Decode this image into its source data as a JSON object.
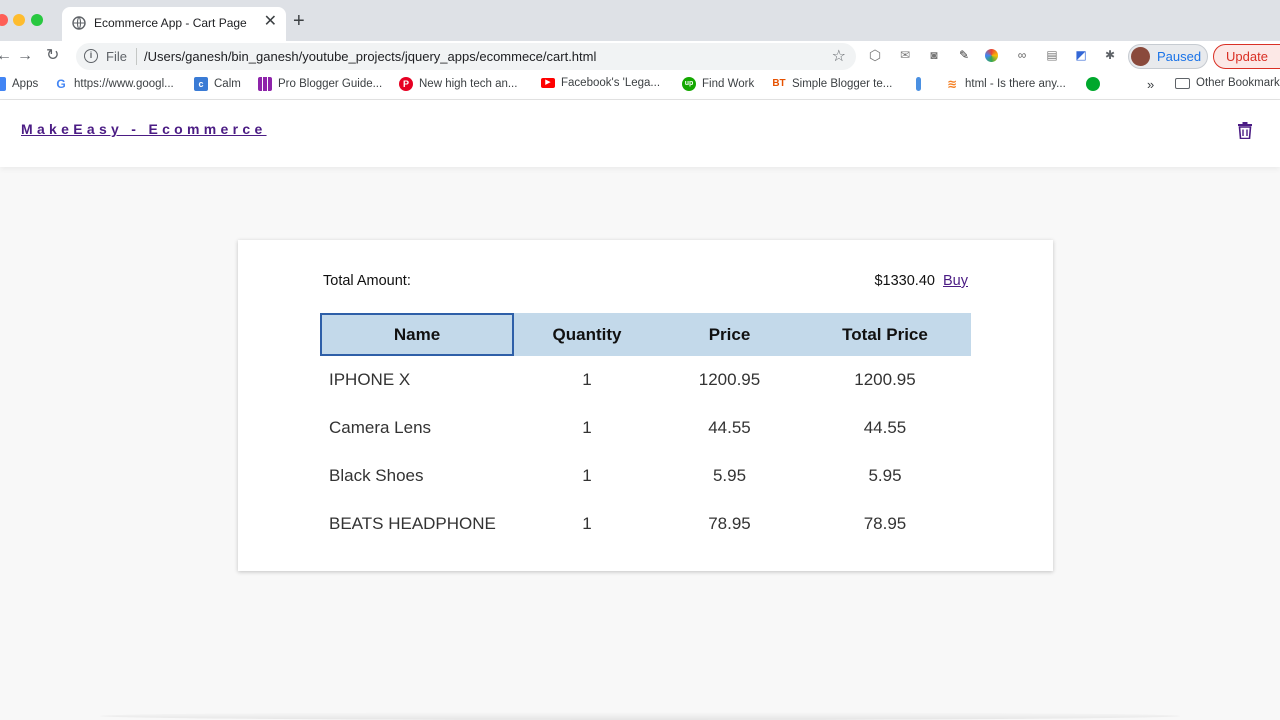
{
  "browser": {
    "tab_title": "Ecommerce App - Cart Page",
    "file_label": "File",
    "url": "/Users/ganesh/bin_ganesh/youtube_projects/jquery_apps/ecommece/cart.html",
    "profile_label": "Paused",
    "update_label": "Update",
    "bookmarks": [
      {
        "icon": "apps-grid-icon",
        "label": "Apps"
      },
      {
        "icon": "google-icon",
        "label": "https://www.googl..."
      },
      {
        "icon": "calm-icon",
        "label": "Calm"
      },
      {
        "icon": "grid-icon",
        "label": "Pro Blogger Guide..."
      },
      {
        "icon": "pinterest-icon",
        "label": "New high tech an..."
      },
      {
        "icon": "youtube-icon",
        "label": "Facebook's 'Lega..."
      },
      {
        "icon": "upwork-icon",
        "label": "Find Work"
      },
      {
        "icon": "blogger-icon",
        "label": "Simple Blogger te..."
      },
      {
        "icon": "stackoverflow-icon",
        "label": "html - Is there any..."
      }
    ],
    "more_bookmarks": "»",
    "other_bookmarks": "Other Bookmarks"
  },
  "app": {
    "brand": "MakeEasy - Ecommerce"
  },
  "cart": {
    "total_label": "Total Amount:",
    "total_value": "$1330.40",
    "buy_label": "Buy",
    "headers": {
      "name": "Name",
      "quantity": "Quantity",
      "price": "Price",
      "total_price": "Total Price"
    },
    "rows": [
      {
        "name": "IPHONE X",
        "quantity": "1",
        "price": "1200.95",
        "total": "1200.95"
      },
      {
        "name": "Camera Lens",
        "quantity": "1",
        "price": "44.55",
        "total": "44.55"
      },
      {
        "name": "Black Shoes",
        "quantity": "1",
        "price": "5.95",
        "total": "5.95"
      },
      {
        "name": "BEATS HEADPHONE",
        "quantity": "1",
        "price": "78.95",
        "total": "78.95"
      }
    ]
  },
  "colors": {
    "brand": "#4b1c84",
    "table_header_bg": "#c3d9ea",
    "selected_outline": "#2e5fa8"
  }
}
